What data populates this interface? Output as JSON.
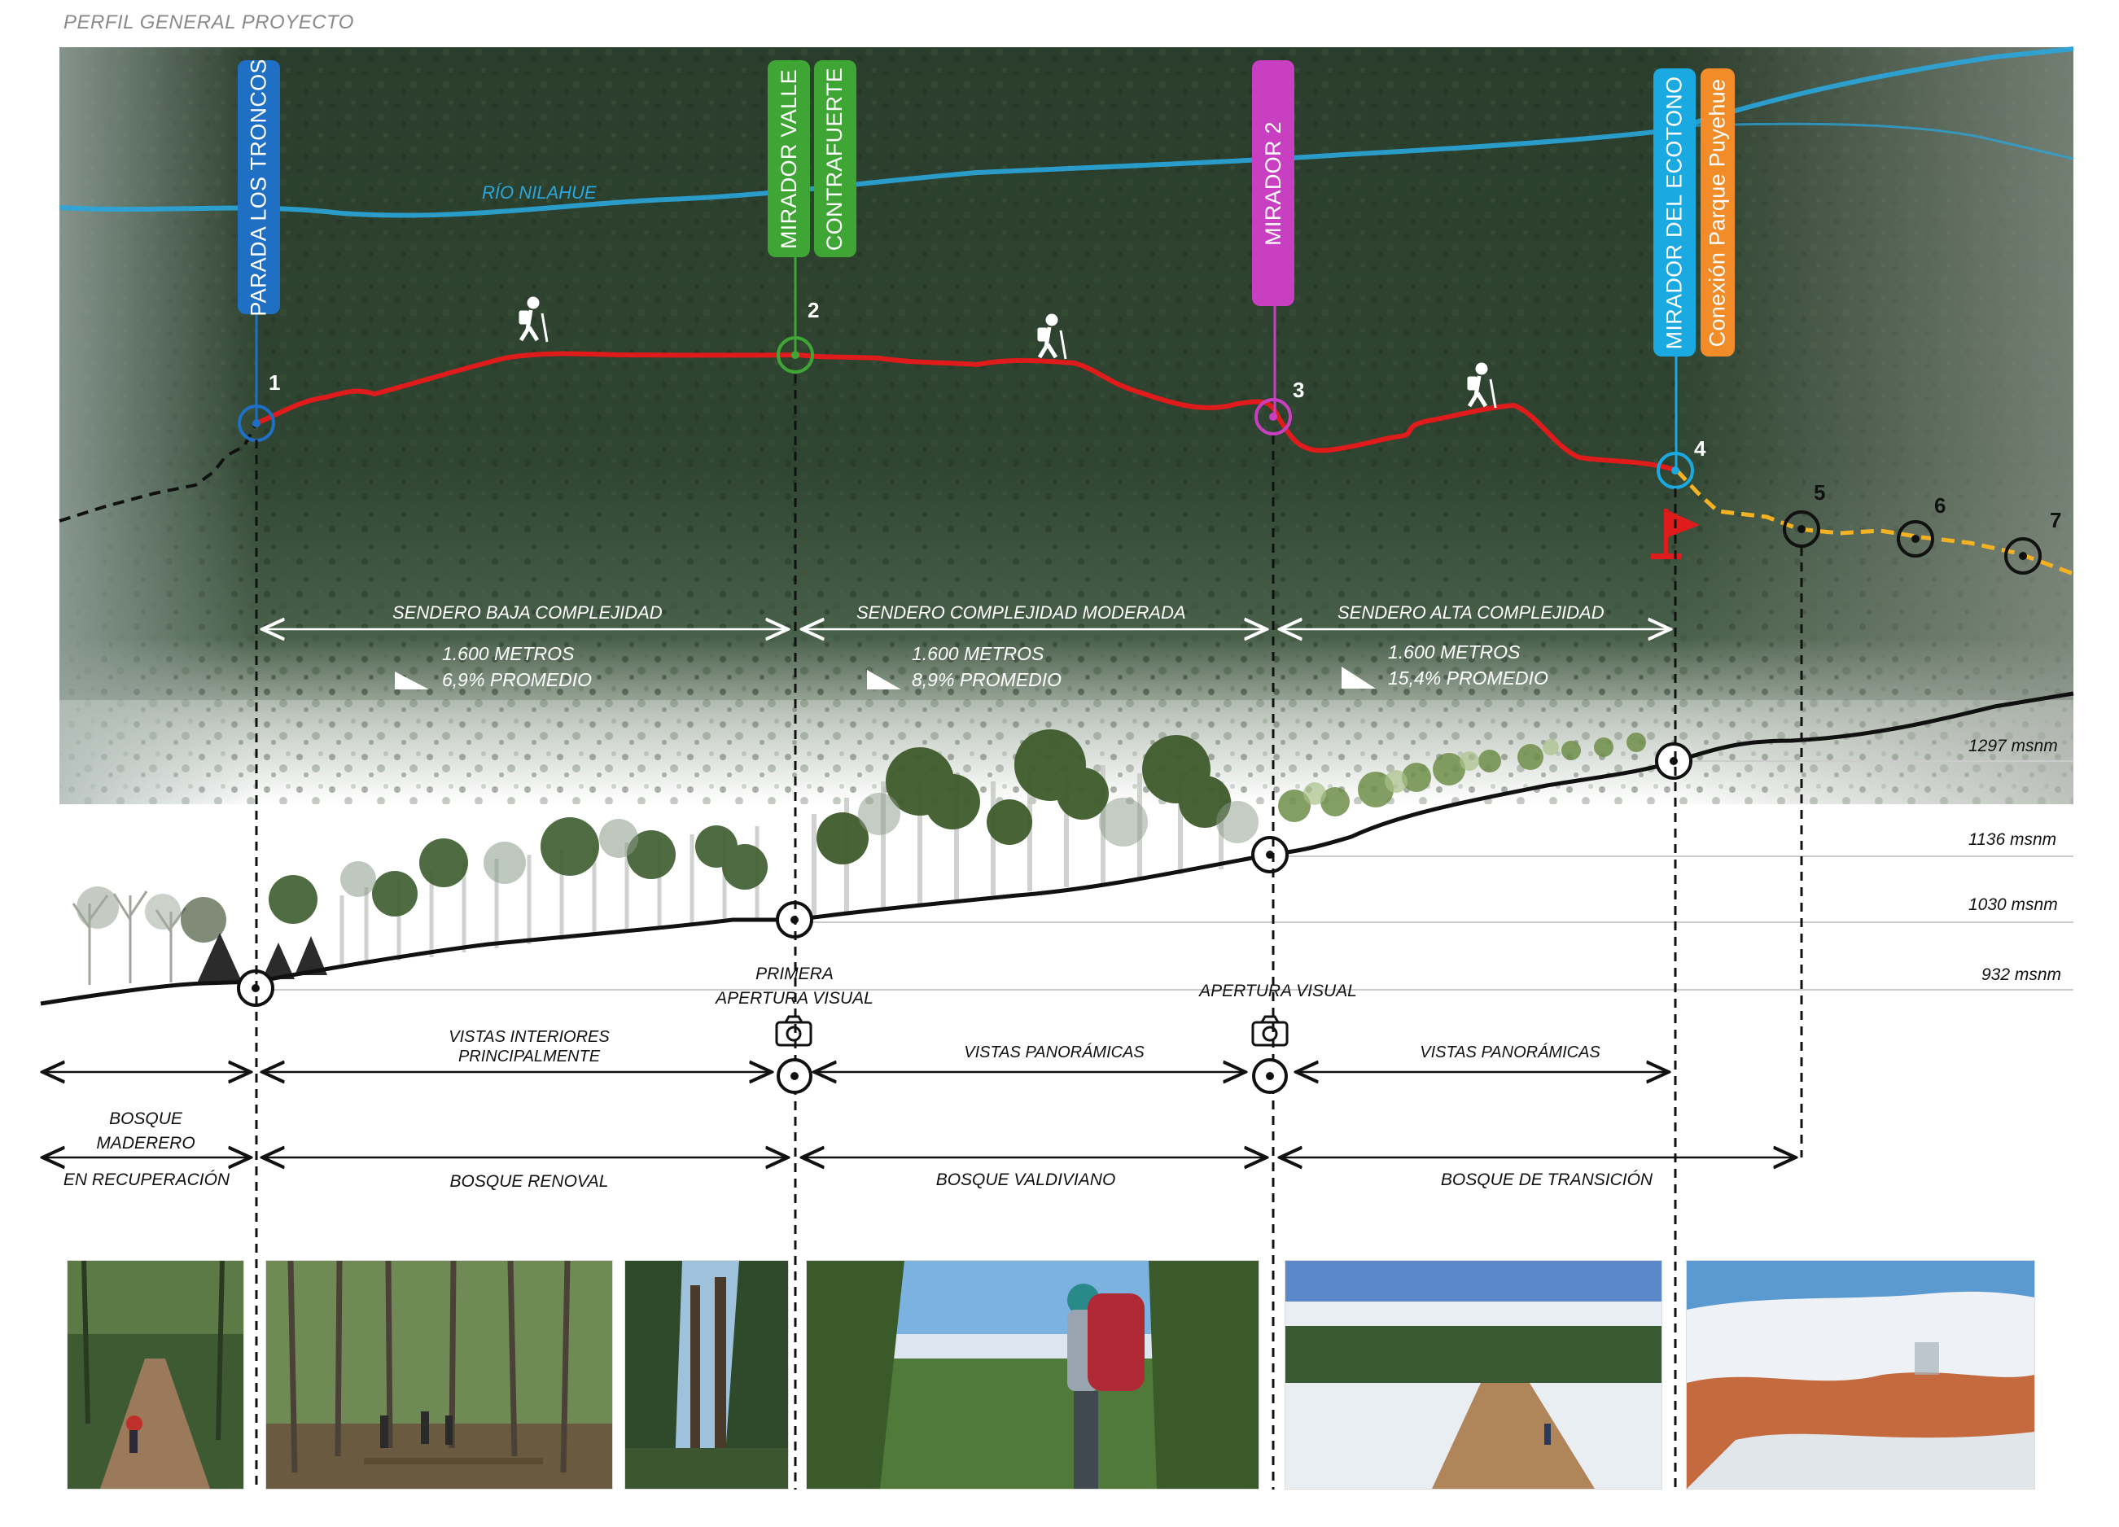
{
  "title": "PERFIL GENERAL PROYECTO",
  "river_label": "RÍO NILAHUE",
  "tags": [
    {
      "text": "PARADA LOS TRONCOS",
      "color": "#1f6fc4"
    },
    {
      "text": "MIRADOR VALLE",
      "color": "#3fa535"
    },
    {
      "text": "CONTRAFUERTE",
      "color": "#3fa535"
    },
    {
      "text": "MIRADOR 2",
      "color": "#c93fc2"
    },
    {
      "text": "MIRADOR DEL ECOTONO",
      "color": "#1aa9e1"
    },
    {
      "text": "Conexión Parque Puyehue",
      "color": "#f28c28"
    }
  ],
  "points": [
    "1",
    "2",
    "3",
    "4",
    "5",
    "6",
    "7"
  ],
  "segments": [
    {
      "name": "SENDERO BAJA COMPLEJIDAD",
      "distance": "1.600 METROS",
      "slope": "6,9% PROMEDIO"
    },
    {
      "name": "SENDERO COMPLEJIDAD MODERADA",
      "distance": "1.600 METROS",
      "slope": "8,9% PROMEDIO"
    },
    {
      "name": "SENDERO ALTA COMPLEJIDAD",
      "distance": "1.600 METROS",
      "slope": "15,4% PROMEDIO"
    }
  ],
  "elevations": [
    "1297 msnm",
    "1136 msnm",
    "1030 msnm",
    "932 msnm"
  ],
  "visual": {
    "first_line1": "PRIMERA",
    "first_line2": "APERTURA VISUAL",
    "second": "APERTURA VISUAL"
  },
  "views": {
    "v1_line1": "VISTAS INTERIORES",
    "v1_line2": "PRINCIPALMENTE",
    "v2": "VISTAS PANORÁMICAS",
    "v3": "VISTAS PANORÁMICAS"
  },
  "forests": {
    "f0_line1": "BOSQUE",
    "f0_line2": "MADERERO",
    "f0_line3": "EN RECUPERACIÓN",
    "f1": "BOSQUE RENOVAL",
    "f2": "BOSQUE VALDIVIANO",
    "f3": "BOSQUE DE TRANSICIÓN"
  },
  "colors": {
    "trail": "#e01b1b",
    "connection": "#f5b223",
    "river": "#2aa6dc",
    "flag": "#e01b1b"
  }
}
